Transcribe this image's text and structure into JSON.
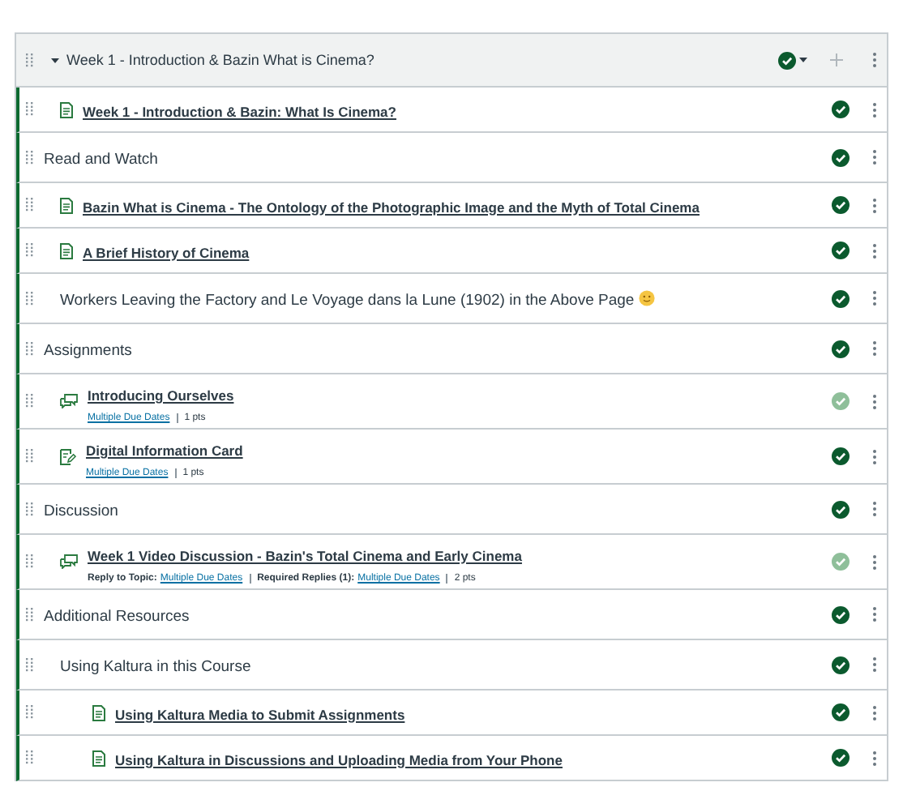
{
  "module": {
    "title": "Week 1 - Introduction & Bazin What is Cinema?",
    "expanded": true,
    "published": true
  },
  "items": [
    {
      "kind": "page",
      "title": "Week 1 - Introduction & Bazin: What Is Cinema?",
      "published": true
    },
    {
      "kind": "header",
      "title": "Read and Watch",
      "published": true
    },
    {
      "kind": "page",
      "title": "Bazin What is Cinema - The Ontology of the Photographic Image and the Myth of Total Cinema",
      "published": true
    },
    {
      "kind": "page",
      "title": "A Brief History of Cinema",
      "published": true,
      "children": [
        {
          "kind": "header",
          "title": "Workers Leaving the Factory and Le Voyage dans la Lune (1902) in the Above Page",
          "emoji": true,
          "published": true
        }
      ]
    },
    {
      "kind": "header",
      "title": "Assignments",
      "published": true
    },
    {
      "kind": "discussion",
      "title": "Introducing Ourselves",
      "published": false,
      "meta": [
        {
          "link": "Multiple Due Dates"
        },
        {
          "text": "1 pts"
        }
      ]
    },
    {
      "kind": "quiz",
      "title": "Digital Information Card",
      "published": true,
      "meta": [
        {
          "link": "Multiple Due Dates"
        },
        {
          "text": "1 pts"
        }
      ]
    },
    {
      "kind": "header",
      "title": "Discussion",
      "published": true
    },
    {
      "kind": "discussion",
      "title": "Week 1 Video Discussion - Bazin's Total Cinema and Early Cinema",
      "published": false,
      "meta": [
        {
          "prefix": "Reply to Topic:",
          "link": "Multiple Due Dates"
        },
        {
          "prefix": "Required Replies (1):",
          "link": "Multiple Due Dates"
        },
        {
          "text": "2 pts"
        }
      ]
    },
    {
      "kind": "header",
      "title": "Additional Resources",
      "published": true,
      "children": [
        {
          "kind": "header",
          "title": "Using Kaltura in this Course",
          "published": true,
          "children": [
            {
              "kind": "page",
              "title": "Using Kaltura Media to Submit Assignments",
              "published": true
            },
            {
              "kind": "page",
              "title": "Using Kaltura in Discussions and Uploading Media from Your Phone",
              "published": true
            }
          ]
        }
      ]
    }
  ]
}
